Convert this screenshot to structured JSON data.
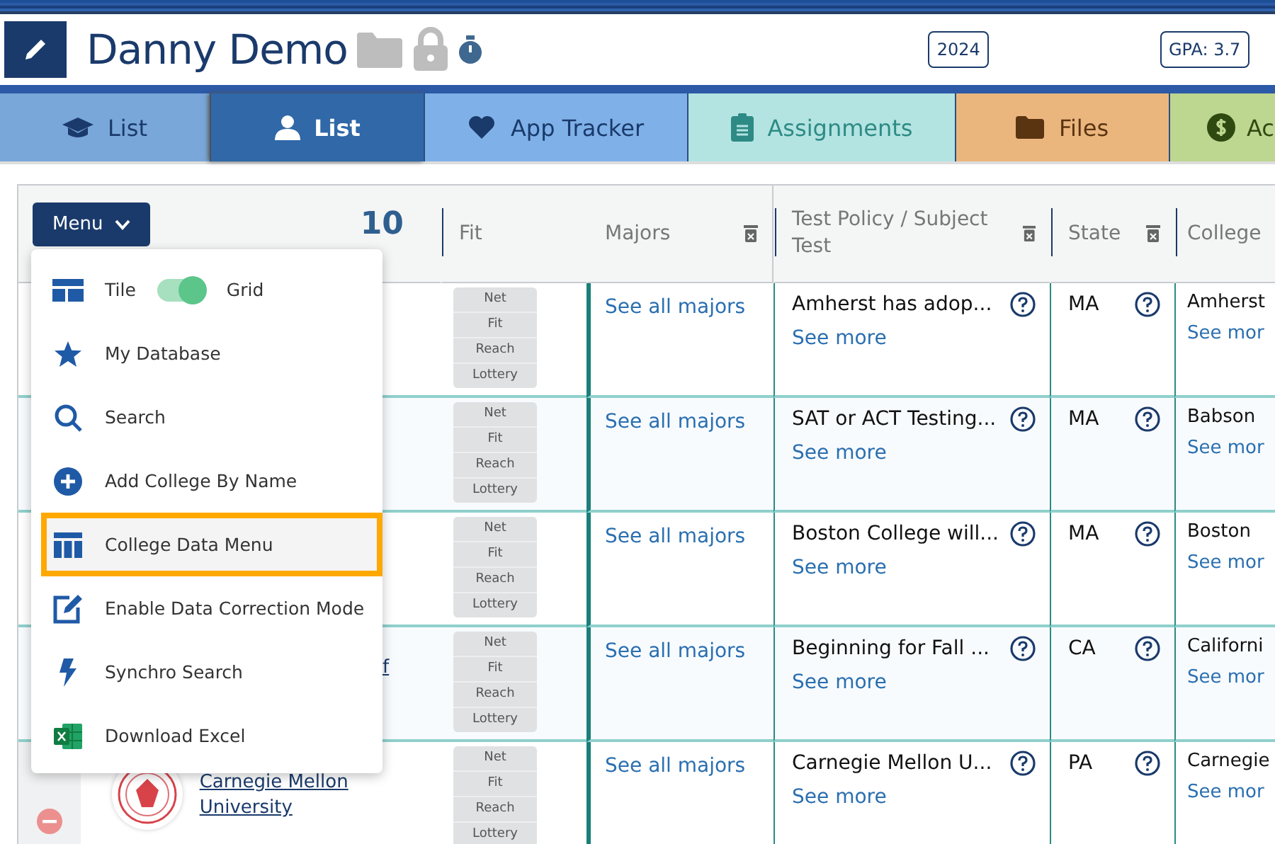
{
  "header": {
    "title": "Danny Demo",
    "badges": [
      "2024",
      "GPA: 3.7"
    ]
  },
  "tabs": [
    {
      "label": "List",
      "selected": false,
      "color": "#7aa7d9"
    },
    {
      "label": "List",
      "selected": true,
      "color": "#3068a8"
    },
    {
      "label": "App Tracker",
      "selected": false,
      "color": "#7fb1e8"
    },
    {
      "label": "Assignments",
      "selected": false,
      "color": "#b3e4e2"
    },
    {
      "label": "Files",
      "selected": false,
      "color": "#ebb67e"
    },
    {
      "label": "Ac",
      "selected": false,
      "color": "#bdd690"
    }
  ],
  "table": {
    "menu_button": "Menu",
    "count": "10",
    "columns": [
      {
        "label": "Fit",
        "removable": false
      },
      {
        "label": "Majors",
        "removable": true
      },
      {
        "label": "Test Policy / Subject Test",
        "removable": true
      },
      {
        "label": "State",
        "removable": true
      },
      {
        "label": "College",
        "removable": false
      }
    ],
    "rows": [
      {
        "fit": [
          "Net",
          "Fit",
          "Reach",
          "Lottery"
        ],
        "majors": "See all majors",
        "policy": "Amherst has adop...",
        "policy_link": "See more",
        "state": "MA",
        "college": "Amherst",
        "college_link": "See mor"
      },
      {
        "fit": [
          "Net",
          "Fit",
          "Reach",
          "Lottery"
        ],
        "majors": "See all majors",
        "policy": "SAT or ACT Testing...",
        "policy_link": "See more",
        "state": "MA",
        "college": "Babson",
        "college_link": "See mor"
      },
      {
        "fit": [
          "Net",
          "Fit",
          "Reach",
          "Lottery"
        ],
        "majors": "See all majors",
        "policy": "Boston College will...",
        "policy_link": "See more",
        "state": "MA",
        "college": "Boston",
        "college_link": "See mor"
      },
      {
        "name": "f",
        "fit": [
          "Net",
          "Fit",
          "Reach",
          "Lottery"
        ],
        "majors": "See all majors",
        "policy": "Beginning for Fall ...",
        "policy_link": "See more",
        "state": "CA",
        "college": "Californi",
        "college_link": "See mor"
      },
      {
        "name": "Carnegie Mellon University",
        "logo": true,
        "removable": true,
        "fit": [
          "Net",
          "Fit",
          "Reach",
          "Lottery"
        ],
        "majors": "See all majors",
        "policy": "Carnegie Mellon U...",
        "policy_link": "See more",
        "state": "PA",
        "college": "Carnegie",
        "college_link": "See mor"
      }
    ]
  },
  "menu": {
    "items": [
      {
        "kind": "toggle",
        "label": "Tile",
        "label_on": "Grid",
        "on": true,
        "highlighted": false
      },
      {
        "kind": "item",
        "label": "My Database",
        "highlighted": false
      },
      {
        "kind": "item",
        "label": "Search",
        "highlighted": false
      },
      {
        "kind": "item",
        "label": "Add College By Name",
        "highlighted": false
      },
      {
        "kind": "item",
        "label": "College Data Menu",
        "highlighted": true
      },
      {
        "kind": "item",
        "label": "Enable Data Correction Mode",
        "highlighted": false
      },
      {
        "kind": "item",
        "label": "Synchro Search",
        "highlighted": false
      },
      {
        "kind": "item",
        "label": "Download Excel",
        "highlighted": false
      }
    ]
  }
}
